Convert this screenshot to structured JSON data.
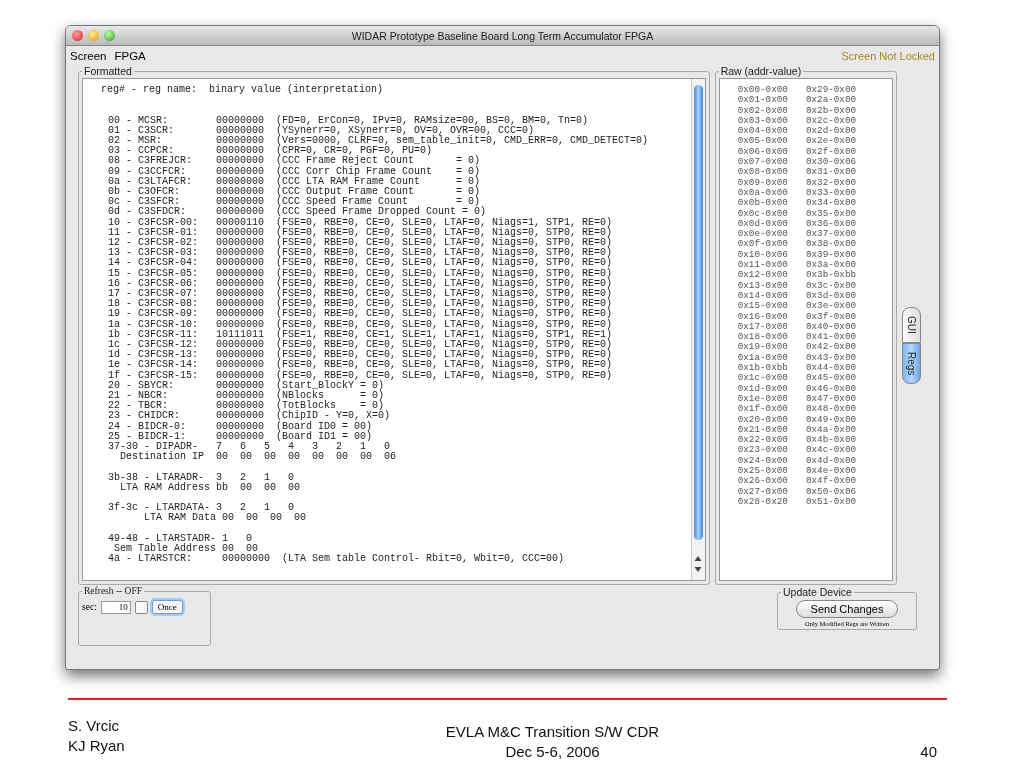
{
  "window": {
    "title": "WIDAR Prototype Baseline Board Long Term Accumulator FPGA"
  },
  "menu": [
    "Screen",
    "FPGA"
  ],
  "lock_status": "Screen Not Locked",
  "formatted": {
    "title": "Formatted",
    "header": "reg# - reg name:  binary value (interpretation)",
    "blocks": [
      [
        "00 - MCSR:        00000000  (FD=0, ErCon=0, IPv=0, RAMsize=00, BS=0, BM=0, Tn=0)",
        "01 - C3SCR:       00000000  (YSynerr=0, XSynerr=0, OV=0, OVR=00, CCC=0)",
        "02 - MSR:         00000000  (Vers=0000, CLRF=0, sem_table_init=0, CMD_ERR=0, CMD_DETECT=0)",
        "03 - CCPCR:       00000000  (CPR=0, CR=0, PGF=0, PU=0)",
        "08 - C3FREJCR:    00000000  (CCC Frame Reject Count       = 0)",
        "09 - C3CCFCR:     00000000  (CCC Corr Chip Frame Count    = 0)",
        "0a - C3LTAFCR:    00000000  (CCC LTA RAM Frame Count      = 0)",
        "0b - C3OFCR:      00000000  (CCC Output Frame Count       = 0)",
        "0c - C3SFCR:      00000000  (CCC Speed Frame Count        = 0)",
        "0d - C3SFDCR:     00000000  (CCC Speed Frame Dropped Count = 0)",
        "10 - C3FCSR-00:   00000110  (FSE=0, RBE=0, CE=0, SLE=0, LTAF=0, Niags=1, STP1, RE=0)",
        "11 - C3FCSR-01:   00000000  (FSE=0, RBE=0, CE=0, SLE=0, LTAF=0, Niags=0, STP0, RE=0)",
        "12 - C3FCSR-02:   00000000  (FSE=0, RBE=0, CE=0, SLE=0, LTAF=0, Niags=0, STP0, RE=0)",
        "13 - C3FCSR-03:   00000000  (FSE=0, RBE=0, CE=0, SLE=0, LTAF=0, Niags=0, STP0, RE=0)",
        "14 - C3FCSR-04:   00000000  (FSE=0, RBE=0, CE=0, SLE=0, LTAF=0, Niags=0, STP0, RE=0)",
        "15 - C3FCSR-05:   00000000  (FSE=0, RBE=0, CE=0, SLE=0, LTAF=0, Niags=0, STP0, RE=0)",
        "16 - C3FCSR-06:   00000000  (FSE=0, RBE=0, CE=0, SLE=0, LTAF=0, Niags=0, STP0, RE=0)",
        "17 - C3FCSR-07:   00000000  (FSE=0, RBE=0, CE=0, SLE=0, LTAF=0, Niags=0, STP0, RE=0)",
        "18 - C3FCSR-08:   00000000  (FSE=0, RBE=0, CE=0, SLE=0, LTAF=0, Niags=0, STP0, RE=0)",
        "19 - C3FCSR-09:   00000000  (FSE=0, RBE=0, CE=0, SLE=0, LTAF=0, Niags=0, STP0, RE=0)",
        "1a - C3FCSR-10:   00000000  (FSE=0, RBE=0, CE=0, SLE=0, LTAF=0, Niags=0, STP0, RE=0)",
        "1b - C3FCSR-11:   10111011  (FSE=1, RBE=0, CE=1, SLE=1, LTAF=1, Niags=0, STP1, RE=1)",
        "1c - C3FCSR-12:   00000000  (FSE=0, RBE=0, CE=0, SLE=0, LTAF=0, Niags=0, STP0, RE=0)",
        "1d - C3FCSR-13:   00000000  (FSE=0, RBE=0, CE=0, SLE=0, LTAF=0, Niags=0, STP0, RE=0)",
        "1e - C3FCSR-14:   00000000  (FSE=0, RBE=0, CE=0, SLE=0, LTAF=0, Niags=0, STP0, RE=0)",
        "1f - C3FCSR-15:   00000000  (FSE=0, RBE=0, CE=0, SLE=0, LTAF=0, Niags=0, STP0, RE=0)",
        "20 - SBYCR:       00000000  (Start_BlockY = 0)",
        "21 - NBCR:        00000000  (NBlocks      = 0)",
        "22 - TBCR:        00000000  (TotBlocks    = 0)",
        "23 - CHIDCR:      00000000  (ChipID - Y=0, X=0)",
        "24 - BIDCR-0:     00000000  (Board ID0 = 00)",
        "25 - BIDCR-1:     00000000  (Board ID1 = 00)",
        "37-30 - DIPADR-   7   6   5   4   3   2   1   0",
        "  Destination IP  00  00  00  00  00  00  00  06"
      ],
      [
        "3b-38 - LTARADR-  3   2   1   0",
        "  LTA RAM Address bb  00  00  00"
      ],
      [
        "3f-3c - LTARDATA- 3   2   1   0",
        "      LTA RAM Data 00  00  00  00"
      ],
      [
        "49-48 - LTARSTADR- 1   0",
        " Sem Table Address 00  00",
        "4a - LTARSTCR:     00000000  (LTA Sem table Control- Rbit=0, Wbit=0, CCC=00)"
      ]
    ]
  },
  "raw": {
    "title": "Raw (addr-value)",
    "left": [
      "0x00-0x00",
      "0x01-0x00",
      "0x02-0x00",
      "0x03-0x00",
      "0x04-0x00",
      "0x05-0x00",
      "0x06-0x00",
      "0x07-0x00",
      "0x08-0x00",
      "0x09-0x00",
      "0x0a-0x00",
      "0x0b-0x00",
      "0x0c-0x00",
      "0x0d-0x00",
      "0x0e-0x00",
      "0x0f-0x00",
      "0x10-0x06",
      "0x11-0x00",
      "0x12-0x00",
      "0x13-0x00",
      "0x14-0x00",
      "0x15-0x00",
      "0x16-0x00",
      "0x17-0x00",
      "0x18-0x00",
      "0x19-0x00",
      "0x1a-0x00",
      "0x1b-0xbb",
      "0x1c-0x00",
      "0x1d-0x00",
      "0x1e-0x00",
      "0x1f-0x00",
      "0x20-0x00",
      "0x21-0x00",
      "0x22-0x00",
      "0x23-0x00",
      "0x24-0x00",
      "0x25-0x00",
      "0x26-0x00",
      "0x27-0x00",
      "0x28-0x20"
    ],
    "right": [
      "0x29-0x00",
      "0x2a-0x00",
      "0x2b-0x00",
      "0x2c-0x00",
      "0x2d-0x00",
      "0x2e-0x00",
      "0x2f-0x00",
      "0x30-0x06",
      "0x31-0x00",
      "0x32-0x00",
      "0x33-0x00",
      "0x34-0x00",
      "0x35-0x00",
      "0x36-0x00",
      "0x37-0x00",
      "0x38-0x00",
      "0x39-0x00",
      "0x3a-0x00",
      "0x3b-0xbb",
      "0x3c-0x00",
      "0x3d-0x00",
      "0x3e-0x00",
      "0x3f-0x00",
      "0x40-0x00",
      "0x41-0x00",
      "0x42-0x00",
      "0x43-0x00",
      "0x44-0x00",
      "0x45-0x00",
      "0x46-0x00",
      "0x47-0x00",
      "0x48-0x00",
      "0x49-0x00",
      "0x4a-0x00",
      "0x4b-0x00",
      "0x4c-0x00",
      "0x4d-0x00",
      "0x4e-0x00",
      "0x4f-0x00",
      "0x50-0x06",
      "0x51-0x00"
    ]
  },
  "side_tabs": [
    {
      "label": "GUI",
      "selected": false
    },
    {
      "label": "Regs",
      "selected": true
    }
  ],
  "refresh": {
    "title": "Refresh -- OFF",
    "sec_label": "sec:",
    "sec_value": "10",
    "checked": false,
    "button": "Once"
  },
  "update": {
    "title": "Update Device",
    "button": "Send Changes",
    "note": "Only Modified Regs are Written"
  },
  "footer": {
    "authors": [
      "S. Vrcic",
      "KJ Ryan"
    ],
    "title": [
      "EVLA M&C Transition S/W CDR",
      "Dec 5-6, 2006"
    ],
    "page": "40"
  }
}
